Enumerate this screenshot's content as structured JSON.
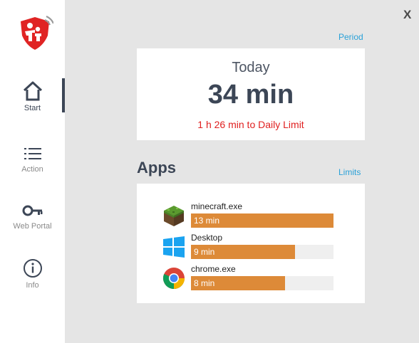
{
  "window": {
    "close_label": "X"
  },
  "sidebar": {
    "items": [
      {
        "label": "Start",
        "icon": "home-icon",
        "active": true
      },
      {
        "label": "Action",
        "icon": "list-icon",
        "active": false
      },
      {
        "label": "Web Portal",
        "icon": "key-icon",
        "active": false
      },
      {
        "label": "Info",
        "icon": "info-icon",
        "active": false
      }
    ]
  },
  "header": {
    "period_link": "Period"
  },
  "today": {
    "title": "Today",
    "value": "34 min",
    "remaining": "1 h 26 min to Daily Limit"
  },
  "apps": {
    "heading": "Apps",
    "limits_link": "Limits",
    "items": [
      {
        "name": "minecraft.exe",
        "time": "13 min",
        "fraction": 1.0,
        "icon": "minecraft-icon"
      },
      {
        "name": "Desktop",
        "time": "9 min",
        "fraction": 0.73,
        "icon": "windows-icon"
      },
      {
        "name": "chrome.exe",
        "time": "8 min",
        "fraction": 0.66,
        "icon": "chrome-icon"
      }
    ]
  },
  "colors": {
    "accent": "#2aa1d8",
    "bar": "#dd8a38",
    "warning": "#e02020",
    "logo": "#e02424",
    "text_dark": "#3c4656"
  }
}
